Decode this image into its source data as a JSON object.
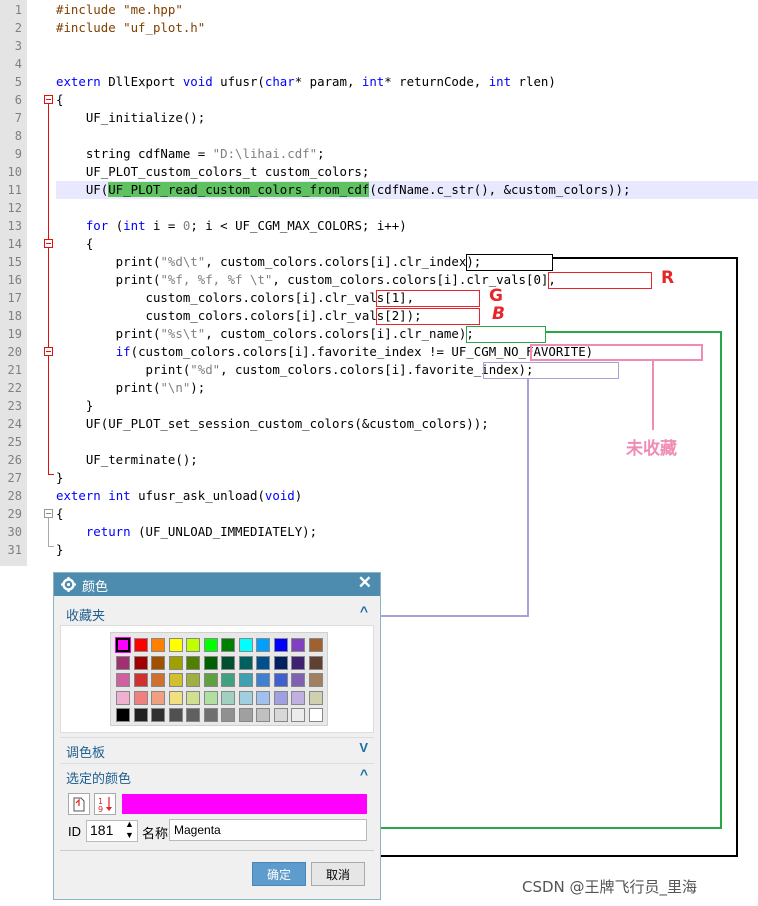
{
  "editor": {
    "line_numbers": [
      "1",
      "2",
      "3",
      "4",
      "5",
      "6",
      "7",
      "8",
      "9",
      "10",
      "11",
      "12",
      "13",
      "14",
      "15",
      "16",
      "17",
      "18",
      "19",
      "20",
      "21",
      "22",
      "23",
      "24",
      "25",
      "26",
      "27",
      "28",
      "29",
      "30",
      "31"
    ],
    "lines": {
      "l1": [
        "#include \"me.hpp\""
      ],
      "l2": [
        "#include \"uf_plot.h\""
      ],
      "l5": [
        "extern",
        " DllExport ",
        "void",
        " ufusr(",
        "char",
        "* param, ",
        "int",
        "* returnCode, ",
        "int",
        " rlen)"
      ],
      "l6": [
        "{"
      ],
      "l7": [
        "    UF_initialize();"
      ],
      "l9": [
        "    string cdfName = ",
        "\"D:\\lihai.cdf\"",
        ";"
      ],
      "l10": [
        "    UF_PLOT_custom_colors_t custom_colors;"
      ],
      "l11": [
        "    UF(",
        "UF_PLOT_read_custom_colors_from_cdf",
        "(cdfName.c_str(), &custom_colors));"
      ],
      "l13": [
        "    ",
        "for",
        " (",
        "int",
        " i = ",
        "0",
        "; i < UF_CGM_MAX_COLORS; i++)"
      ],
      "l14": [
        "    {"
      ],
      "l15": [
        "        print(",
        "\"%d\\t\"",
        ", custom_colors.colors[i].",
        "clr_index",
        ");"
      ],
      "l16": [
        "        print(",
        "\"%f, %f, %f \\t\"",
        ", custom_colors.colors[i].",
        "clr_vals[0]",
        ","
      ],
      "l17": [
        "            custom_colors.colors[i].",
        "clr_vals[1]",
        ","
      ],
      "l18": [
        "            custom_colors.colors[i].",
        "clr_vals[2]",
        ");"
      ],
      "l19": [
        "        print(",
        "\"%s\\t\"",
        ", custom_colors.colors[i].",
        "clr_name",
        ");"
      ],
      "l20": [
        "        ",
        "if",
        "(custom_colors.colors[i].favorite_index != ",
        "UF_CGM_NO_FAVORITE",
        ")"
      ],
      "l21": [
        "            print(",
        "\"%d\"",
        ", custom_colors.colors[i].",
        "favorite_index",
        ");"
      ],
      "l22": [
        "        print(",
        "\"\\n\"",
        ");"
      ],
      "l23": [
        "    }"
      ],
      "l24": [
        "    UF(UF_PLOT_set_session_custom_colors(&custom_colors));"
      ],
      "l26": [
        "    UF_terminate();"
      ],
      "l27": [
        "}"
      ],
      "l28": [
        "extern",
        " ",
        "int",
        " ufusr_ask_unload(",
        "void",
        ")"
      ],
      "l29": [
        "{"
      ],
      "l30": [
        "    ",
        "return",
        " (UF_UNLOAD_IMMEDIATELY);"
      ],
      "l31": [
        "}"
      ]
    }
  },
  "annotations": {
    "r": "R",
    "g": "G",
    "b": "B",
    "not_favorite": "未收藏",
    "colors": {
      "red": "#e8262a",
      "green": "#27a745",
      "black": "#000000",
      "purple": "#a7a3d6",
      "pink": "#f08cb4"
    }
  },
  "dialog": {
    "title": "颜色",
    "close_icon": "close-icon",
    "gear_icon": "gear-icon",
    "favorites_label": "收藏夹",
    "palette_label": "调色板",
    "selected_label": "选定的颜色",
    "id_label": "ID",
    "id_value": "181",
    "name_label": "名称",
    "name_value": "Magenta",
    "selected_color": "#ff00ff",
    "ok_label": "确定",
    "cancel_label": "取消",
    "swatches": [
      [
        "#ff00ff",
        "#ff0000",
        "#ff8000",
        "#ffff00",
        "#c0ff00",
        "#00ff00",
        "#008000",
        "#00ffff",
        "#00a0ff",
        "#0000ff",
        "#8040c0",
        "#a06030"
      ],
      [
        "#a03070",
        "#a00000",
        "#a05000",
        "#a0a000",
        "#508000",
        "#006000",
        "#005030",
        "#006060",
        "#005090",
        "#002060",
        "#402070",
        "#604030"
      ],
      [
        "#d060a0",
        "#d03030",
        "#d07030",
        "#d0c030",
        "#a0b040",
        "#60a040",
        "#40a080",
        "#40a0b0",
        "#4080d0",
        "#4060d0",
        "#8060b0",
        "#a08060"
      ],
      [
        "#f0b0d0",
        "#f08080",
        "#f0a080",
        "#f0e080",
        "#d0e090",
        "#b0e0a0",
        "#a0d0c0",
        "#a0d0e0",
        "#a0c0f0",
        "#a0a0e0",
        "#c0b0e0",
        "#d0d0b0"
      ],
      [
        "#000000",
        "#202020",
        "#303030",
        "#505050",
        "#606060",
        "#707070",
        "#909090",
        "#a0a0a0",
        "#c0c0c0",
        "#d8d8d8",
        "#ececec",
        "#ffffff"
      ]
    ]
  },
  "watermark": "CSDN @王牌飞行员_里海"
}
